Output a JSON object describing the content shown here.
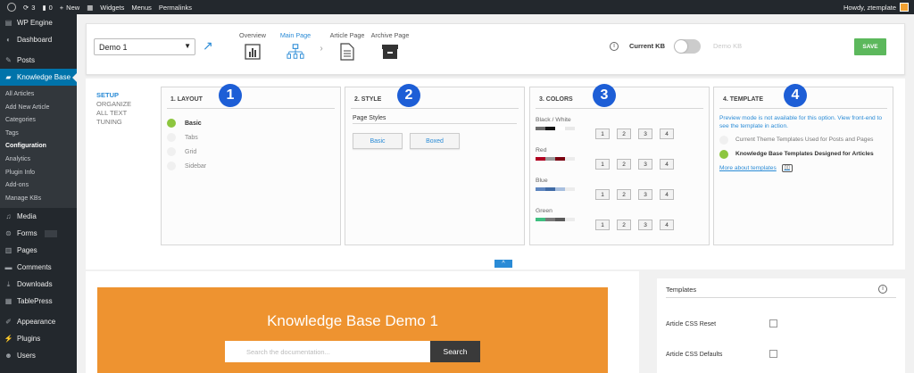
{
  "adminbar": {
    "updates_count": "3",
    "comments_count": "0",
    "new_label": "New",
    "links": [
      "Widgets",
      "Menus",
      "Permalinks"
    ],
    "howdy": "Howdy, ztemplate"
  },
  "sidebar": {
    "top_items": [
      {
        "label": "WP Engine",
        "icon": "server-icon"
      },
      {
        "label": "Dashboard",
        "icon": "dashboard-icon"
      },
      {
        "label": "Posts",
        "icon": "pin-icon"
      },
      {
        "label": "Knowledge Base",
        "icon": "graduation-cap-icon"
      }
    ],
    "submenu": [
      "All Articles",
      "Add New Article",
      "Categories",
      "Tags",
      "Configuration",
      "Analytics",
      "Plugin Info",
      "Add-ons",
      "Manage KBs"
    ],
    "submenu_current": "Configuration",
    "bottom_items": [
      {
        "label": "Media",
        "icon": "media-icon"
      },
      {
        "label": "Forms",
        "icon": "forms-icon"
      },
      {
        "label": "Pages",
        "icon": "pages-icon"
      },
      {
        "label": "Comments",
        "icon": "comments-icon"
      },
      {
        "label": "Downloads",
        "icon": "download-icon"
      },
      {
        "label": "TablePress",
        "icon": "table-icon"
      },
      {
        "label": "Appearance",
        "icon": "brush-icon"
      },
      {
        "label": "Plugins",
        "icon": "plugin-icon"
      },
      {
        "label": "Users",
        "icon": "users-icon"
      }
    ]
  },
  "toolbar": {
    "kb_selected": "Demo 1",
    "tabs": [
      {
        "label": "Overview",
        "icon": "bar-chart-icon"
      },
      {
        "label": "Main Page",
        "icon": "sitemap-icon",
        "active": true
      },
      {
        "label": "Article Page",
        "icon": "document-icon"
      },
      {
        "label": "Archive Page",
        "icon": "archive-box-icon"
      }
    ],
    "current_kb_label": "Current KB",
    "demo_kb_label": "Demo KB",
    "save_label": "SAVE"
  },
  "config": {
    "left_nav": [
      "SETUP",
      "ORGANIZE",
      "ALL TEXT",
      "TUNING"
    ],
    "left_nav_active": "SETUP",
    "layout": {
      "badge": "1",
      "title": "1. LAYOUT",
      "options": [
        "Basic",
        "Tabs",
        "Grid",
        "Sidebar"
      ],
      "selected": "Basic"
    },
    "style": {
      "badge": "2",
      "title": "2. STYLE",
      "section_label": "Page Styles",
      "buttons": [
        "Basic",
        "Boxed"
      ]
    },
    "colors": {
      "badge": "3",
      "title": "3. COLORS",
      "rows": [
        {
          "name": "Black / White",
          "swatch": [
            "#6d6d6d",
            "#111111",
            "#ffffff",
            "#e8e8e8"
          ]
        },
        {
          "name": "Red",
          "swatch": [
            "#b00020",
            "#9a9a9a",
            "#7a0010",
            "#ececec"
          ]
        },
        {
          "name": "Blue",
          "swatch": [
            "#5e86c0",
            "#3f6aa5",
            "#a8bfdf",
            "#ececec"
          ]
        },
        {
          "name": "Green",
          "swatch": [
            "#3fbf80",
            "#7a7a7a",
            "#5a5a5a",
            "#ececec"
          ]
        }
      ],
      "numbers": [
        "1",
        "2",
        "3",
        "4"
      ]
    },
    "template": {
      "badge": "4",
      "title": "4. TEMPLATE",
      "note": "Preview mode is not available for this option. View front-end to see the template in action.",
      "options": [
        "Current Theme Templates Used for Posts and Pages",
        "Knowledge Base Templates Designed for Articles"
      ],
      "selected_index": 1,
      "more_link": "More about templates"
    },
    "collapse_glyph": "^"
  },
  "preview": {
    "kb_title": "Knowledge Base Demo 1",
    "search_placeholder": "Search the documentation...",
    "search_button": "Search",
    "banner_color": "#ee9330"
  },
  "templates_panel": {
    "title": "Templates",
    "settings": [
      "Article CSS Reset",
      "Article CSS Defaults"
    ]
  },
  "colors": {
    "accent": "#2a8bd6",
    "wp_blue": "#0073aa",
    "save_green": "#5cb85c",
    "badge_blue": "#1d5ed6"
  }
}
